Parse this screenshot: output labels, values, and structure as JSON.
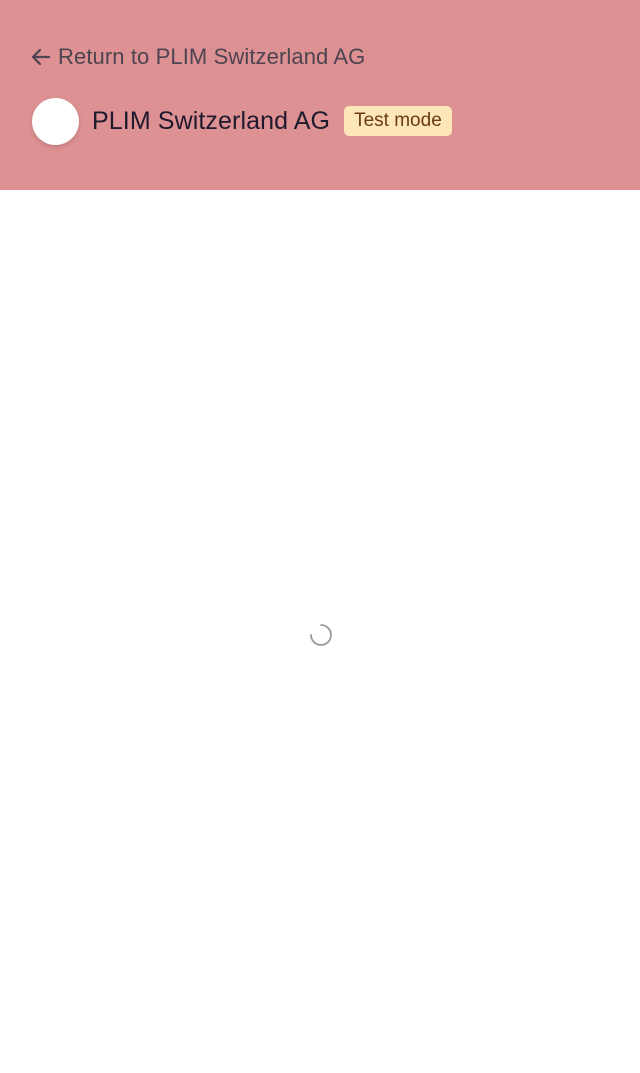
{
  "header": {
    "back_label": "Return to PLIM Switzerland AG",
    "back_icon": "arrow-left-icon",
    "merchant_name": "PLIM Switzerland AG",
    "badge_label": "Test mode"
  },
  "content": {
    "loading_icon": "spinner-icon"
  },
  "colors": {
    "header_bg": "#de9192",
    "badge_bg": "#fde7b8",
    "badge_text": "#6b3a10",
    "title_text": "#1f1a2e",
    "back_text": "#4d4451"
  }
}
